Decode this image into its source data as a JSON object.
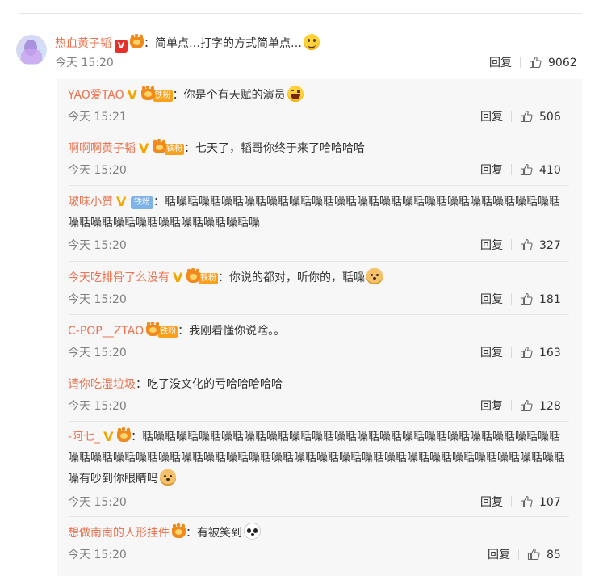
{
  "main": {
    "name": "热血黄子韬",
    "text": "：简单点…打字的方式简单点…",
    "time": "今天 15:20",
    "reply_label": "回复",
    "likes": "9062"
  },
  "replies": [
    {
      "name": "YAO爱TAO",
      "fan": "铁粉",
      "text": "：你是个有天赋的演员",
      "time": "今天 15:21",
      "reply_label": "回复",
      "likes": "506"
    },
    {
      "name": "啊啊啊黄子韬",
      "fan": "铁粉",
      "text": "：七天了，韬哥你终于来了哈哈哈哈",
      "time": "今天 15:20",
      "reply_label": "回复",
      "likes": "410"
    },
    {
      "name": "啵味小赞",
      "fan": "铁粉",
      "text": "：聒噪聒噪聒噪聒噪聒噪聒噪聒噪聒噪聒噪聒噪聒噪聒噪聒噪聒噪聒噪聒噪聒噪聒噪聒噪聒噪聒噪聒噪聒噪聒噪聒噪聒噪",
      "time": "今天 15:20",
      "reply_label": "回复",
      "likes": "327"
    },
    {
      "name": "今天吃排骨了么没有",
      "fan": "铁粉",
      "text": "：你说的都对，听你的，聒噪",
      "time": "今天 15:20",
      "reply_label": "回复",
      "likes": "181"
    },
    {
      "name": "C-POP__ZTAO",
      "fan": "铁粉",
      "text": "：我刚看懂你说啥。。",
      "time": "今天 15:20",
      "reply_label": "回复",
      "likes": "163"
    },
    {
      "name": "请你吃湿垃圾",
      "text": "：吃了没文化的亏哈哈哈哈哈",
      "time": "今天 15:20",
      "reply_label": "回复",
      "likes": "128"
    },
    {
      "name": "-阿七_",
      "text": "：聒噪聒噪聒噪聒噪聒噪聒噪聒噪聒噪聒噪聒噪聒噪聒噪聒噪聒噪聒噪聒噪聒噪聒噪聒噪聒噪聒噪聒噪聒噪聒噪聒噪聒噪聒噪聒噪聒噪聒噪聒噪聒噪聒噪聒噪聒噪聒噪聒噪聒噪聒噪聒噪聒噪有吵到你眼睛吗",
      "time": "今天 15:20",
      "reply_label": "回复",
      "likes": "107"
    },
    {
      "name": "想做南南的人形挂件",
      "text": "：有被笑到",
      "time": "今天 15:20",
      "reply_label": "回复",
      "likes": "85"
    }
  ],
  "colors": {
    "name": "#eb7350",
    "time": "#808080",
    "accent_gold": "#f3a600",
    "vip_red": "#e5302c"
  },
  "icons": [
    "verified-red-icon",
    "verified-gold-icon",
    "crown-icon",
    "thumb-up-icon",
    "emoji-smile-icon",
    "emoji-laugh-icon",
    "emoji-dog-icon",
    "emoji-panda-icon"
  ]
}
